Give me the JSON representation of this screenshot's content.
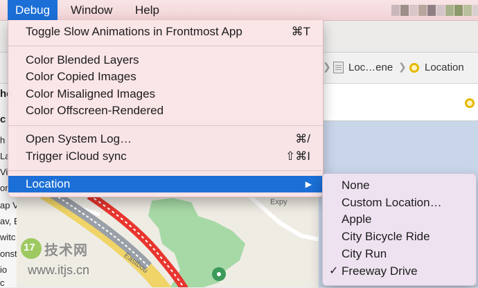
{
  "menubar": {
    "items": [
      "Debug",
      "Window",
      "Help"
    ],
    "accent": "#1b6fd6"
  },
  "jumpbar": {
    "crumb_file": "Loc…ene",
    "crumb_location": "Location"
  },
  "left_pane": {
    "fragments": [
      "he",
      "c",
      "h",
      "La",
      "Vi",
      "on",
      "ap V",
      "av, E",
      "witc",
      "onst",
      "io",
      "c"
    ]
  },
  "map": {
    "labels": [
      "Expy",
      "Eastbou"
    ]
  },
  "debug_menu": {
    "items": [
      {
        "label": "Toggle Slow Animations in Frontmost App",
        "shortcut": "⌘T"
      },
      {
        "label": "Color Blended Layers",
        "shortcut": ""
      },
      {
        "label": "Color Copied Images",
        "shortcut": ""
      },
      {
        "label": "Color Misaligned Images",
        "shortcut": ""
      },
      {
        "label": "Color Offscreen-Rendered",
        "shortcut": ""
      },
      {
        "label": "Open System Log…",
        "shortcut": "⌘/"
      },
      {
        "label": "Trigger iCloud sync",
        "shortcut": "⇧⌘I"
      },
      {
        "label": "Location",
        "shortcut": "",
        "submenu_arrow": "▶",
        "selected": true
      }
    ]
  },
  "location_submenu": {
    "items": [
      {
        "label": "None",
        "checked": false
      },
      {
        "label": "Custom Location…",
        "checked": false
      },
      {
        "label": "Apple",
        "checked": false
      },
      {
        "label": "City Bicycle Ride",
        "checked": false
      },
      {
        "label": "City Run",
        "checked": false
      },
      {
        "label": "Freeway Drive",
        "checked": true
      }
    ],
    "check_mark": "✓"
  },
  "watermark": {
    "logo_text": "17",
    "site_name": "技术网",
    "url": "www.itjs.cn"
  }
}
